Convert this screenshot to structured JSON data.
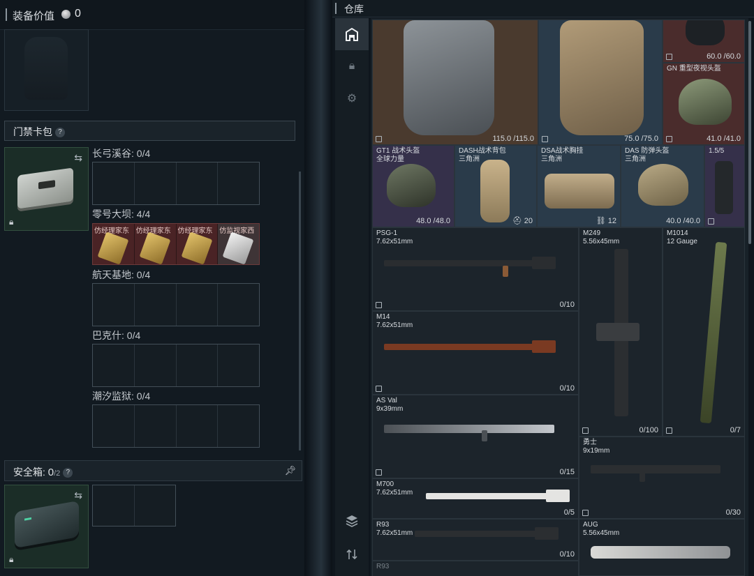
{
  "left": {
    "header": {
      "title": "装备价值",
      "value": "0"
    },
    "keycard_pack": {
      "title": "门禁卡包",
      "help": "?",
      "zones": [
        {
          "label": "长弓溪谷: 0/4"
        },
        {
          "label": "零号大坝: 4/4",
          "cards": [
            "仿经理家东",
            "仿经理家东",
            "仿经理家东",
            "仿监视家西"
          ]
        },
        {
          "label": "航天基地: 0/4"
        },
        {
          "label": "巴克什: 0/4"
        },
        {
          "label": "潮汐监狱: 0/4"
        }
      ]
    },
    "safe_box": {
      "title": "安全箱:",
      "count": "0",
      "capacity": "/2",
      "help": "?"
    }
  },
  "warehouse": {
    "title": "仓库",
    "items": [
      {
        "name": "",
        "durability": "115.0 /115.0",
        "rarity": "orange"
      },
      {
        "name": "",
        "durability": "75.0 /75.0",
        "rarity": "blue"
      },
      {
        "name": "",
        "durability": "60.0 /60.0",
        "rarity": "red"
      },
      {
        "name": "GN 重型夜视头盔",
        "durability": "41.0 /41.0",
        "rarity": "red"
      },
      {
        "name": "GT1 战术头盔",
        "sub": "全球力量",
        "durability": "48.0 /48.0",
        "rarity": "purple"
      },
      {
        "name": "DASH战术背包",
        "sub": "三角洲",
        "count": "20",
        "rarity": "blue"
      },
      {
        "name": "DSA战术胸挂",
        "sub": "三角洲",
        "count": "12",
        "rarity": "blue"
      },
      {
        "name": "DAS 防弹头盔",
        "sub": "三角洲",
        "durability": "40.0 /40.0",
        "rarity": "blue"
      },
      {
        "name": "1.5/5",
        "rarity": "purple"
      },
      {
        "name": "PSG-1",
        "sub": "7.62x51mm",
        "ammo": "0/10"
      },
      {
        "name": "M249",
        "sub": "5.56x45mm",
        "ammo": "0/100"
      },
      {
        "name": "M1014",
        "sub": "12 Gauge",
        "ammo": "0/7"
      },
      {
        "name": "M14",
        "sub": "7.62x51mm",
        "ammo": "0/10"
      },
      {
        "name": "AS Val",
        "sub": "9x39mm",
        "ammo": "0/15"
      },
      {
        "name": "勇士",
        "sub": "9x19mm",
        "ammo": "0/30"
      },
      {
        "name": "M700",
        "sub": "7.62x51mm",
        "ammo": "0/5"
      },
      {
        "name": "R93",
        "sub": "7.62x51mm",
        "ammo": "0/10"
      },
      {
        "name": "AUG",
        "sub": "5.56x45mm",
        "ammo": ""
      },
      {
        "name": "R93"
      }
    ]
  },
  "colors": {
    "orange": "#4a3a2e",
    "blue": "#2a3b4a",
    "purple": "#35304a",
    "red": "#4a2c2c",
    "case_green": "#1b2d27"
  }
}
